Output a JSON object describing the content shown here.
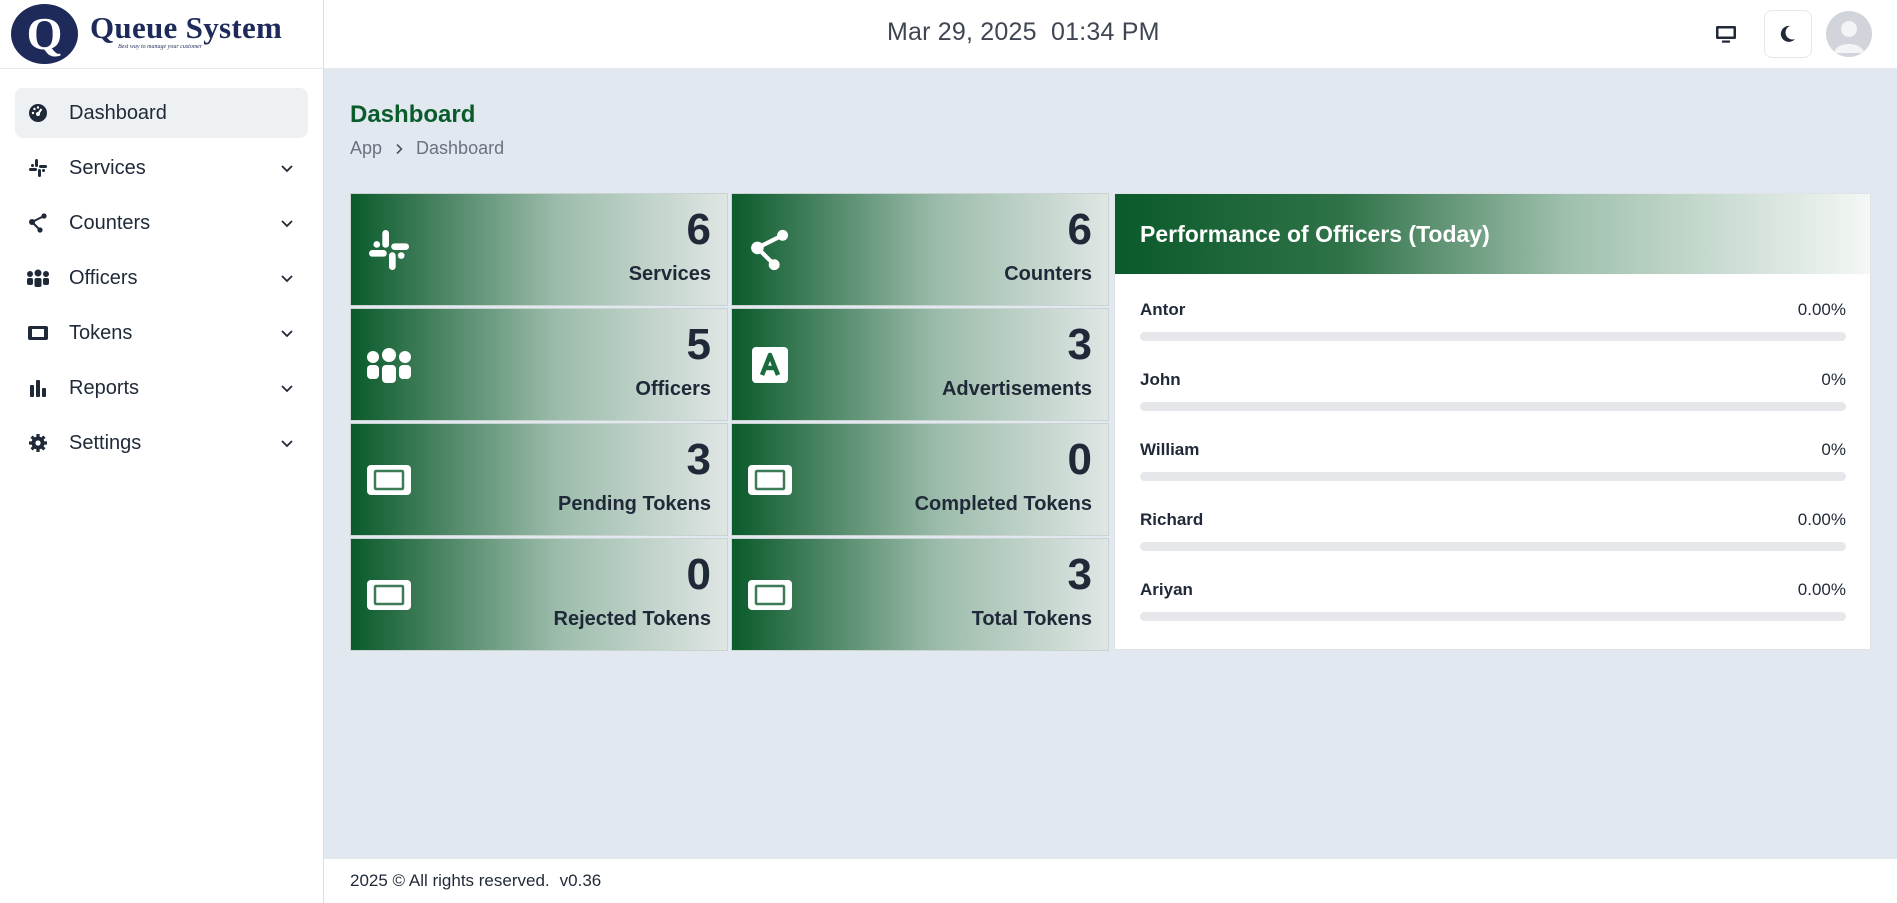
{
  "brand": {
    "logo_letter": "Q",
    "name": "Queue System",
    "tagline": "Best way to manage your customer"
  },
  "header": {
    "date": "Mar 29, 2025",
    "time": "01:34 PM",
    "icons": [
      "monitor-icon",
      "moon-icon",
      "avatar"
    ]
  },
  "sidebar": {
    "items": [
      {
        "label": "Dashboard",
        "icon": "dashboard-icon",
        "active": true
      },
      {
        "label": "Services",
        "icon": "slack-icon"
      },
      {
        "label": "Counters",
        "icon": "share-icon"
      },
      {
        "label": "Officers",
        "icon": "people-icon"
      },
      {
        "label": "Tokens",
        "icon": "ticket-icon"
      },
      {
        "label": "Reports",
        "icon": "bar-chart-icon"
      },
      {
        "label": "Settings",
        "icon": "gear-icon"
      }
    ]
  },
  "page": {
    "title": "Dashboard",
    "breadcrumb": [
      "App",
      "Dashboard"
    ]
  },
  "cards": [
    {
      "value": "6",
      "label": "Services",
      "icon": "slack-icon"
    },
    {
      "value": "6",
      "label": "Counters",
      "icon": "share-icon"
    },
    {
      "value": "5",
      "label": "Officers",
      "icon": "people-icon"
    },
    {
      "value": "3",
      "label": "Advertisements",
      "icon": "ad-icon"
    },
    {
      "value": "3",
      "label": "Pending Tokens",
      "icon": "ticket-icon"
    },
    {
      "value": "0",
      "label": "Completed Tokens",
      "icon": "ticket-icon"
    },
    {
      "value": "0",
      "label": "Rejected Tokens",
      "icon": "ticket-icon"
    },
    {
      "value": "3",
      "label": "Total Tokens",
      "icon": "ticket-icon"
    }
  ],
  "performance": {
    "title": "Performance of Officers (Today)",
    "officers": [
      {
        "name": "Antor",
        "value": "0.00%",
        "percent": 0
      },
      {
        "name": "John",
        "value": "0%",
        "percent": 0
      },
      {
        "name": "William",
        "value": "0%",
        "percent": 0
      },
      {
        "name": "Richard",
        "value": "0.00%",
        "percent": 0
      },
      {
        "name": "Ariyan",
        "value": "0.00%",
        "percent": 0
      }
    ]
  },
  "footer": {
    "copyright": "2025 © All rights reserved.",
    "version": "v0.36"
  },
  "colors": {
    "brand_navy": "#1e2a5a",
    "accent_green": "#0a5c2c",
    "background": "#e2e8f0"
  }
}
